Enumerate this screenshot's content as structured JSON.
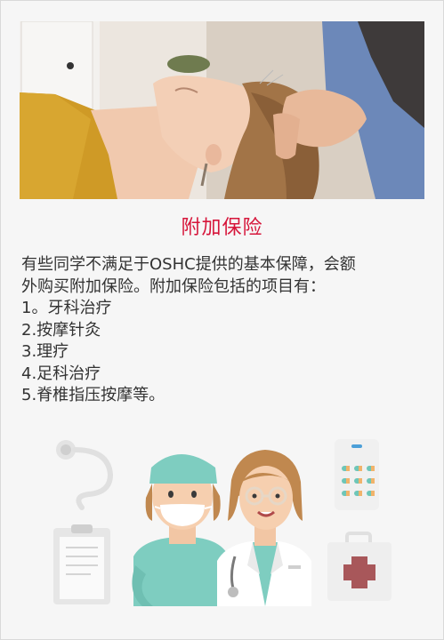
{
  "article": {
    "title": "附加保险",
    "intro_line1": "有些同学不满足于OSHC提供的基本保障，会额",
    "intro_line2": "外购买附加保险。附加保险包括的项目有：",
    "items": [
      "1。牙科治疗",
      "2.按摩针灸",
      "3.理疗",
      "4.足科治疗",
      "5.脊椎指压按摩等。"
    ]
  },
  "photo": {
    "subject": "acupuncture-head-massage-photo"
  },
  "illustration": {
    "subject": "doctor-nurse-medical-illustration"
  },
  "colors": {
    "accent": "#d6153a",
    "text": "#333333",
    "background": "#f6f6f6"
  }
}
